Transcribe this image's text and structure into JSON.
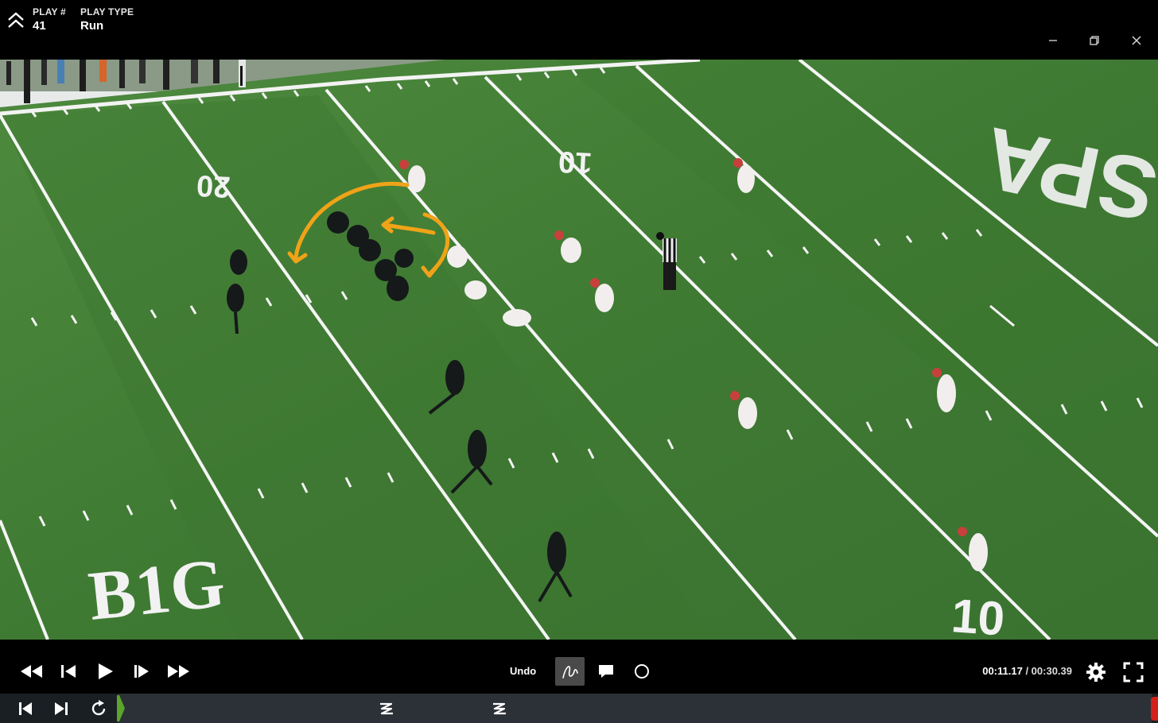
{
  "header": {
    "play_number_label": "PLAY #",
    "play_number_value": "41",
    "play_type_label": "PLAY TYPE",
    "play_type_value": "Run"
  },
  "video": {
    "field_numbers": [
      "20",
      "10",
      "10"
    ],
    "conference_logo": "B1G",
    "end_zone_text": "SPA",
    "annotation_color": "#f0a318"
  },
  "controls": {
    "undo_label": "Undo",
    "current_time": "00:11.17",
    "separator": " / ",
    "duration": "00:30.39",
    "icons": [
      "rewind-icon",
      "step-back-icon",
      "play-icon",
      "step-forward-icon",
      "fast-forward-icon",
      "freehand-draw-icon",
      "comment-icon",
      "circle-tool-icon",
      "settings-icon",
      "fullscreen-icon"
    ]
  },
  "timeline": {
    "playhead_color": "#5ba52a",
    "end_color": "#d3201b",
    "markers": [
      "draw-marker-icon",
      "draw-marker-icon"
    ]
  }
}
